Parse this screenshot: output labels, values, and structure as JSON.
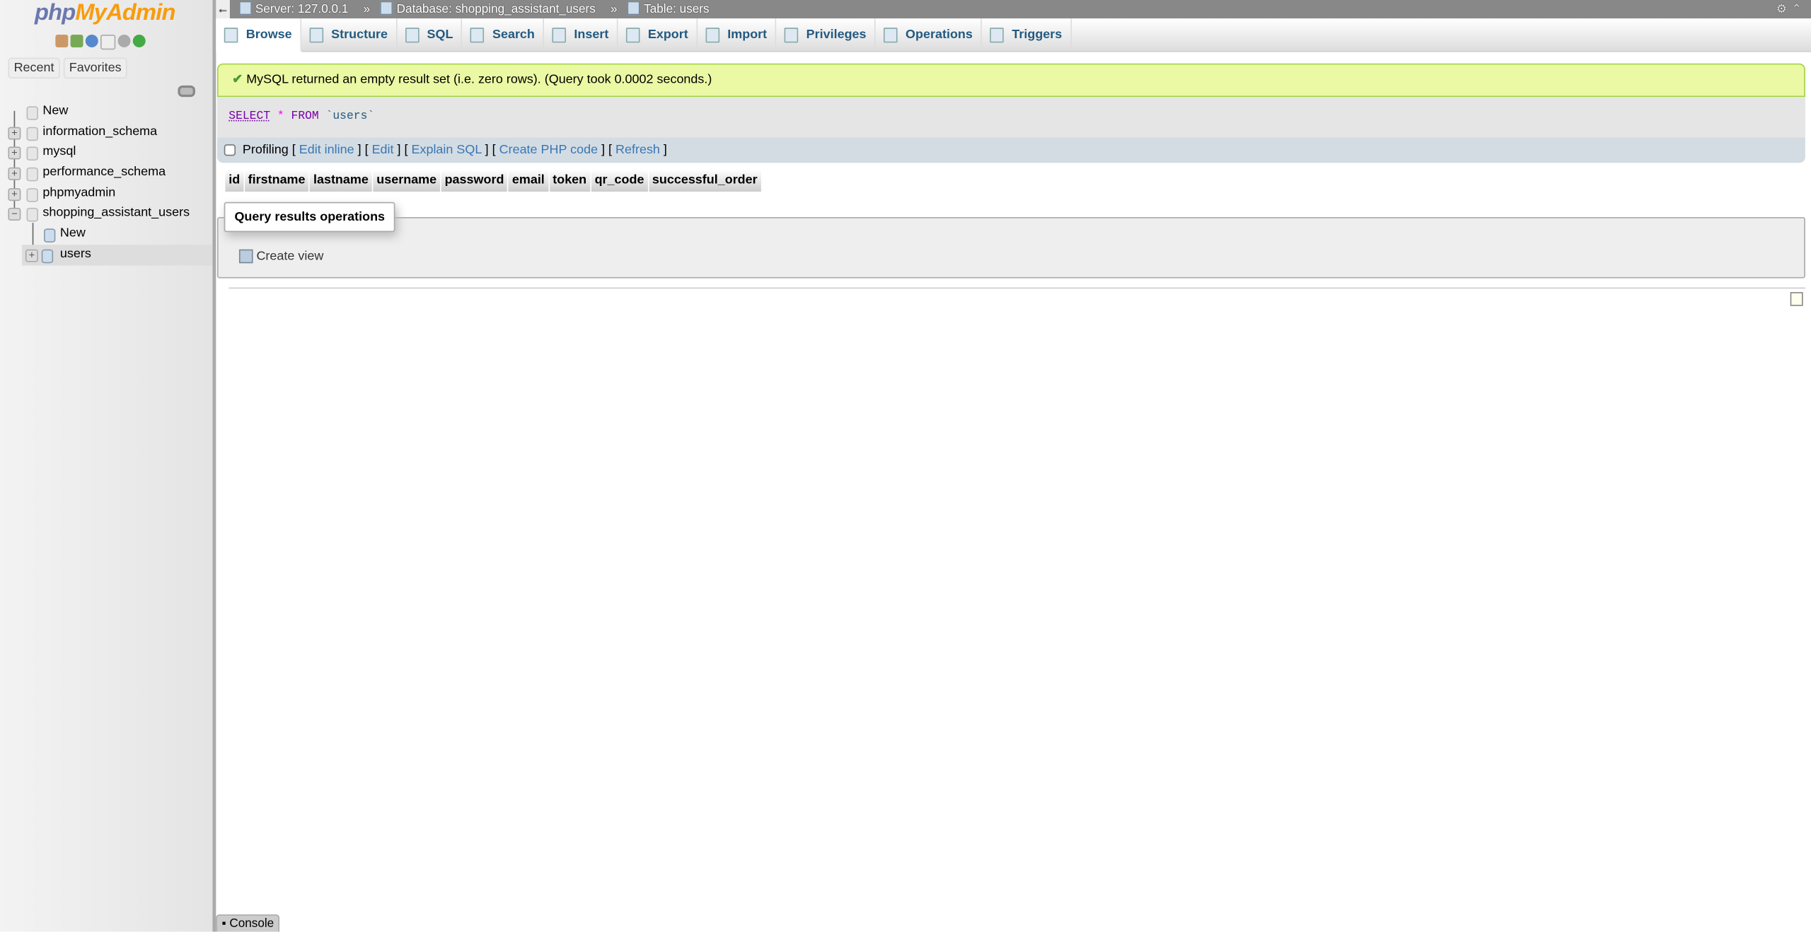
{
  "sidebar": {
    "logo": {
      "php": "php",
      "myadmin": "MyAdmin"
    },
    "tabs": {
      "recent": "Recent",
      "favorites": "Favorites"
    },
    "tree": {
      "new": "New",
      "databases": [
        "information_schema",
        "mysql",
        "performance_schema",
        "phpmyadmin",
        "shopping_assistant_users"
      ],
      "children": {
        "new": "New",
        "table": "users"
      }
    }
  },
  "topbar": {
    "back": "←",
    "server": "Server: 127.0.0.1",
    "database": "Database: shopping_assistant_users",
    "table": "Table: users",
    "sep": "»"
  },
  "tabs": [
    "Browse",
    "Structure",
    "SQL",
    "Search",
    "Insert",
    "Export",
    "Import",
    "Privileges",
    "Operations",
    "Triggers"
  ],
  "main": {
    "success_message": "MySQL returned an empty result set (i.e. zero rows). (Query took 0.0002 seconds.)",
    "sql": {
      "select": "SELECT",
      "star": "*",
      "from": "FROM",
      "table": "`users`"
    },
    "profiling": {
      "label": "Profiling",
      "links": [
        "Edit inline",
        "Edit",
        "Explain SQL",
        "Create PHP code",
        "Refresh"
      ]
    },
    "columns": [
      "id",
      "firstname",
      "lastname",
      "username",
      "password",
      "email",
      "token",
      "qr_code",
      "successful_order"
    ],
    "operations": {
      "legend": "Query results operations",
      "create_view": "Create view"
    }
  },
  "console": "Console"
}
